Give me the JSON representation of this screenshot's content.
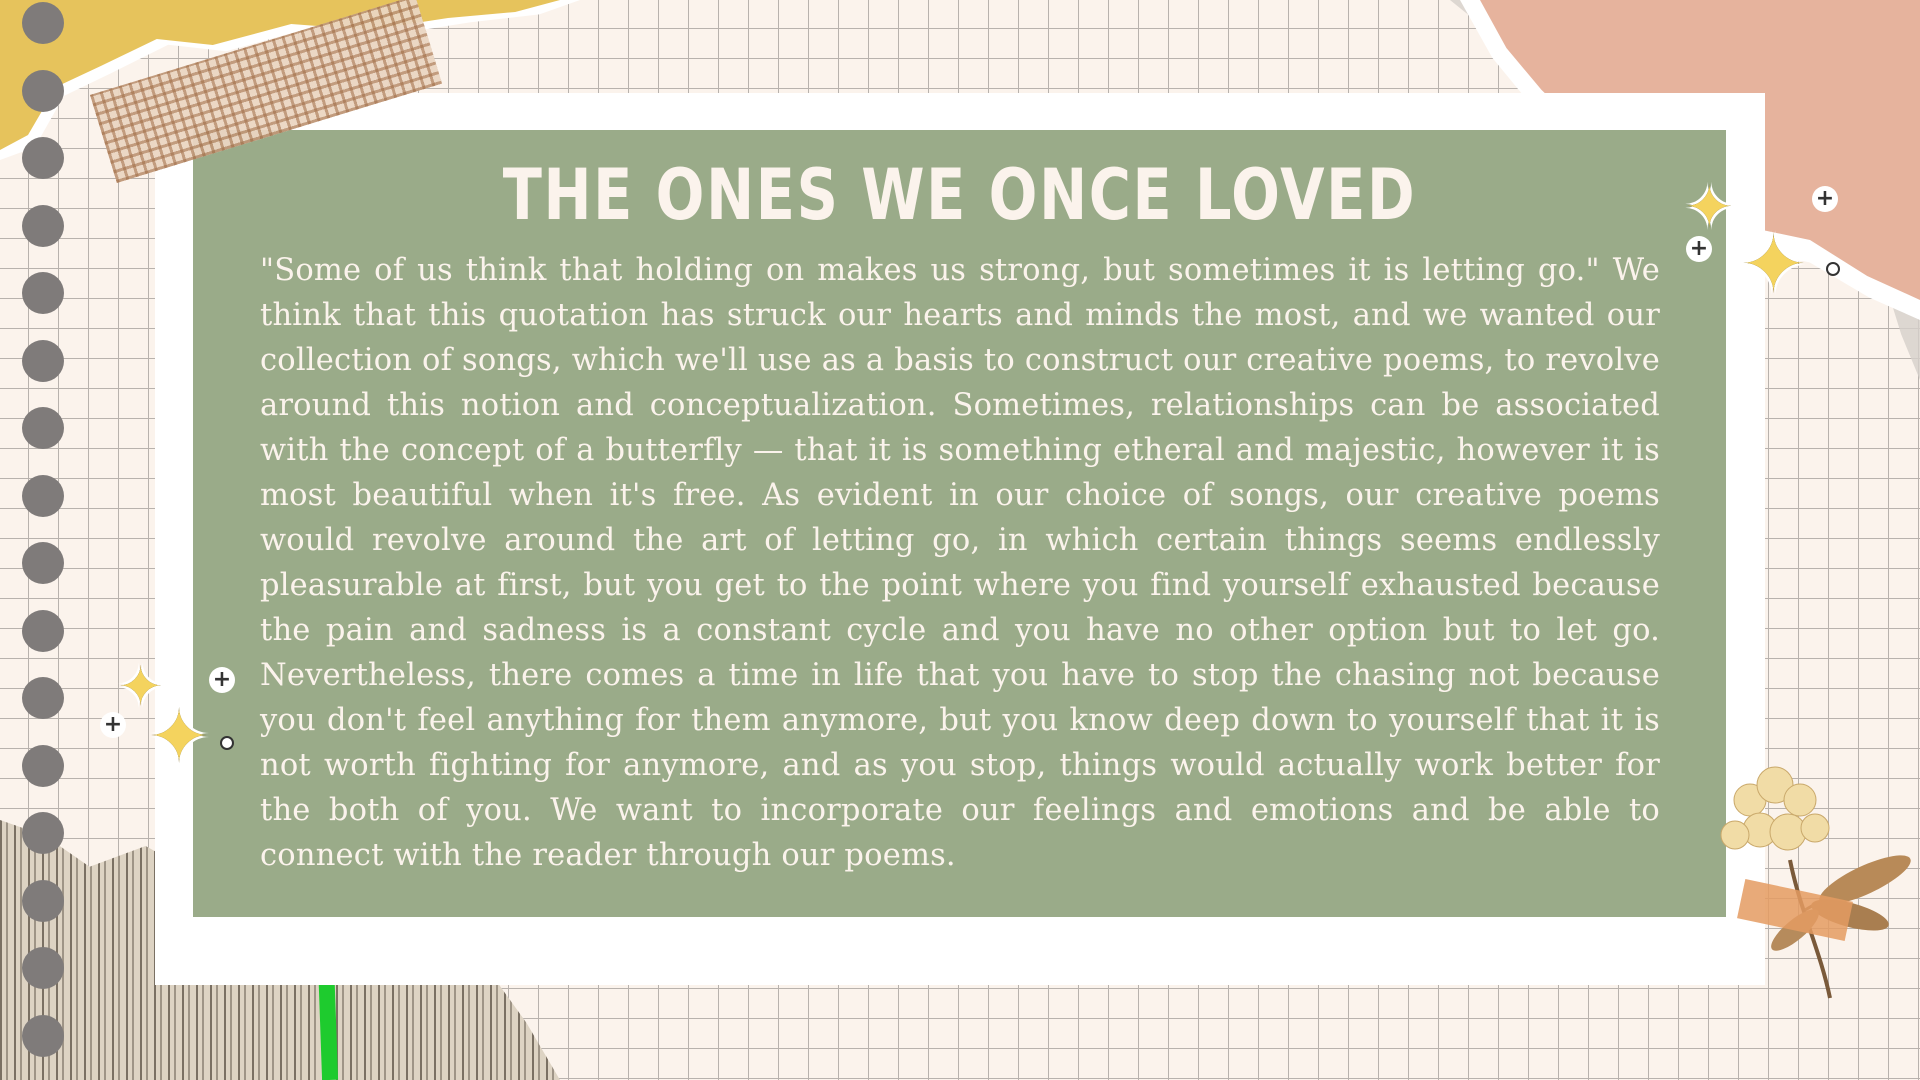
{
  "slide": {
    "title": "The Ones We Once Loved",
    "body": "\"Some of us think that holding on makes us strong, but sometimes it is letting go.\" We think that this quotation has struck our hearts and minds the most, and we wanted our collection of songs, which we'll use as a basis to construct our creative poems, to revolve around this notion and conceptualization. Sometimes, relationships can be associated with the concept of a butterfly — that it is something etheral and majestic, however it is most beautiful when it's free. As evident in our choice of songs, our creative poems would revolve around the art of letting go, in which certain things seems endlessly pleasurable at first, but you get to the point where you find yourself exhausted because the pain and sadness is a constant cycle and you have no other option but to let go. Nevertheless, there comes a time in life that you have to stop the chasing not because you don't feel anything for them anymore, but you know deep down to yourself that it is not worth fighting for anymore, and as you stop, things would actually work better for the both of you. We want to incorporate our feelings and emotions and be able to connect with the reader through our poems."
  },
  "decorations": {
    "icons": [
      "sparkle-star-icon",
      "plus-sparkle-icon",
      "flower-icon",
      "plaid-tape-icon",
      "binder-hole-icon"
    ]
  },
  "colors": {
    "background": "#fbf3ec",
    "grid": "#b8b2ad",
    "card": "#9aab89",
    "text": "#fbf3ec",
    "yellow_paper": "#e6c35c",
    "pink_paper": "#e6b39d",
    "star": "#f4d35e",
    "hole": "#7f7b7a"
  }
}
